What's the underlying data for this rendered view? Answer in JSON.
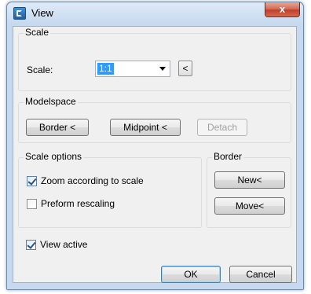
{
  "window": {
    "title": "View",
    "close_glyph": "x",
    "icon": "app-icon"
  },
  "scale_group": {
    "title": "Scale",
    "field_label": "Scale:",
    "combo_value": "1:1",
    "pick_button_glyph": "<"
  },
  "modelspace_group": {
    "title": "Modelspace",
    "border_button": "Border <",
    "midpoint_button": "Midpoint <",
    "detach_button": "Detach"
  },
  "scale_options_group": {
    "title": "Scale options",
    "zoom_label": "Zoom according to scale",
    "zoom_checked": true,
    "preform_label": "Preform rescaling",
    "preform_checked": false
  },
  "border_group": {
    "title": "Border",
    "new_button": "New<",
    "move_button": "Move<"
  },
  "view_active": {
    "label": "View active",
    "checked": true
  },
  "footer": {
    "ok_button": "OK",
    "cancel_button": "Cancel"
  }
}
